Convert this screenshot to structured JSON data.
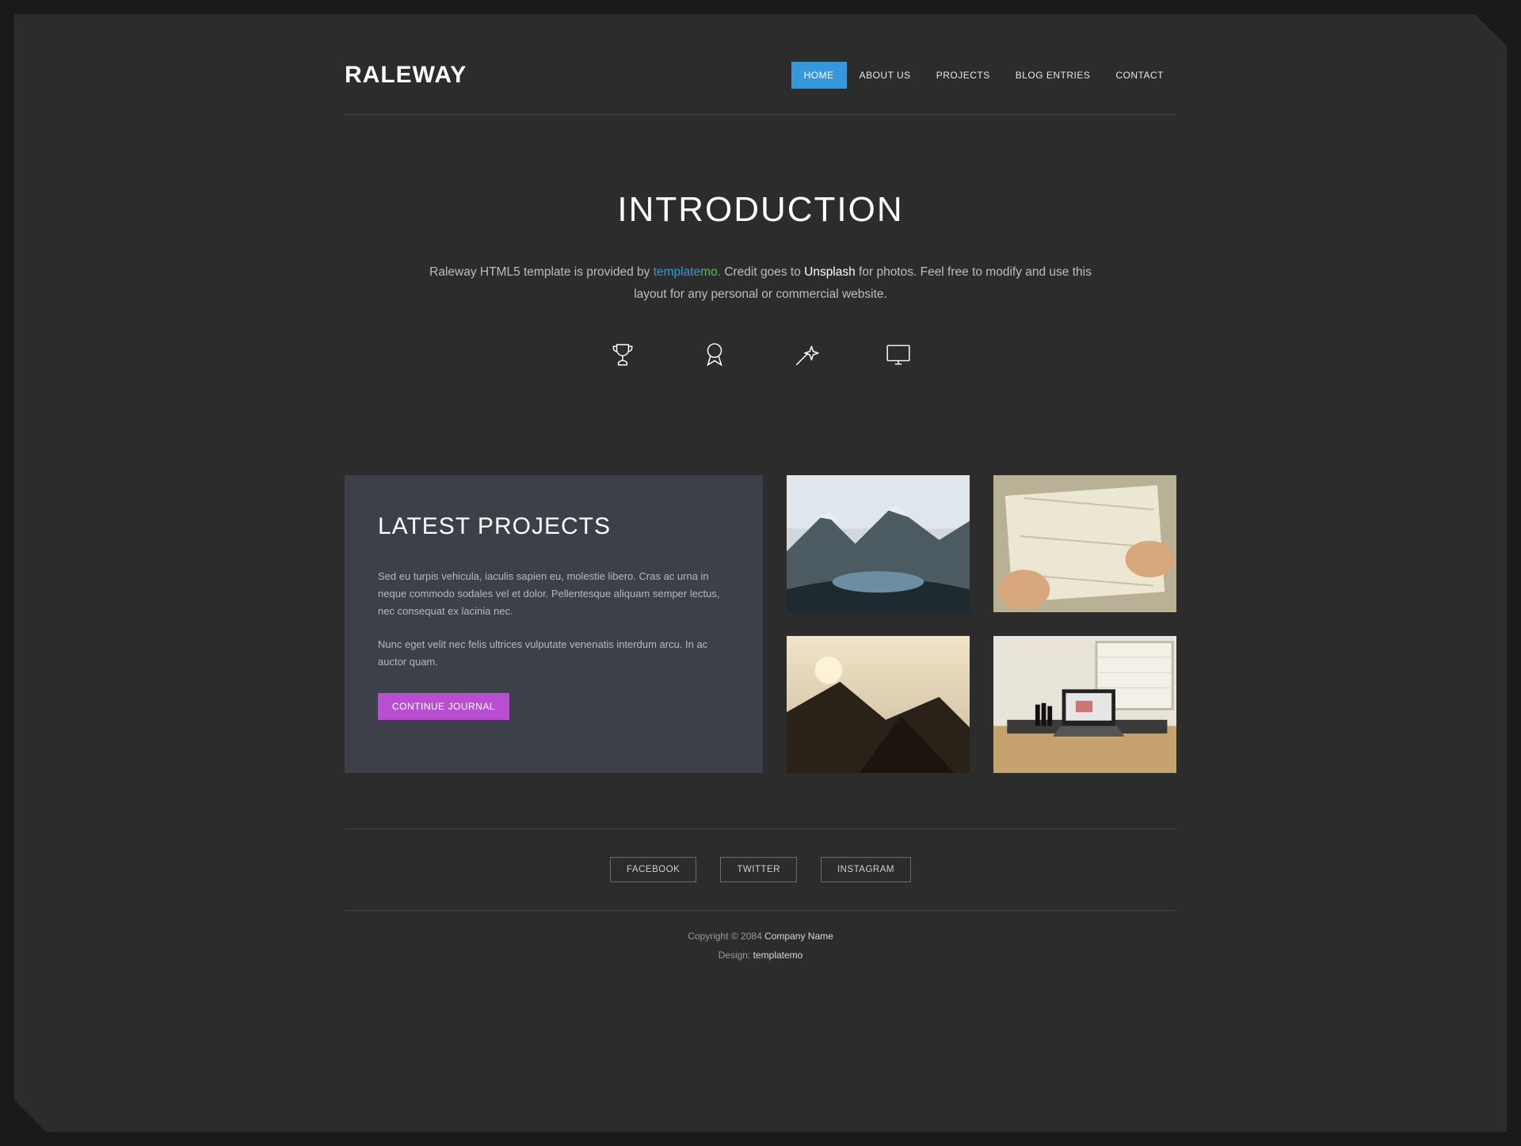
{
  "header": {
    "logo": "RALEWAY",
    "nav": [
      {
        "label": "HOME",
        "active": true
      },
      {
        "label": "ABOUT US",
        "active": false
      },
      {
        "label": "PROJECTS",
        "active": false
      },
      {
        "label": "BLOG ENTRIES",
        "active": false
      },
      {
        "label": "CONTACT",
        "active": false
      }
    ]
  },
  "intro": {
    "heading": "INTRODUCTION",
    "text_before": "Raleway HTML5 template is provided by ",
    "link_template": "template",
    "link_mo": "mo",
    "dot": ".",
    "text_mid": " Credit goes to ",
    "link_unsplash": "Unsplash",
    "text_after": " for photos. Feel free to modify and use this layout for any personal or commercial website.",
    "icons": [
      "trophy-icon",
      "badge-icon",
      "wand-icon",
      "monitor-icon"
    ]
  },
  "projects": {
    "heading": "LATEST PROJECTS",
    "para1": "Sed eu turpis vehicula, iaculis sapien eu, molestie libero. Cras ac urna in neque commodo sodales vel et dolor. Pellentesque aliquam semper lectus, nec consequat ex lacinia nec.",
    "para2": "Nunc eget velit nec felis ultrices vulputate venenatis interdum arcu. In ac auctor quam.",
    "button_label": "CONTINUE JOURNAL",
    "thumbs": [
      "mountain-lake",
      "map-hands",
      "coastal-rocks",
      "desk-laptop"
    ]
  },
  "footer": {
    "social": [
      "FACEBOOK",
      "TWITTER",
      "INSTAGRAM"
    ],
    "copyright_prefix": "Copyright © 2084 ",
    "company": "Company Name",
    "design_prefix": "Design: ",
    "design_link": "templatemo"
  },
  "colors": {
    "accent_blue": "#3598db",
    "accent_purple": "#b84fd1",
    "bg_outer": "#1a1a1a",
    "bg_page": "#2c2c2c",
    "bg_panel": "#3d4049"
  }
}
